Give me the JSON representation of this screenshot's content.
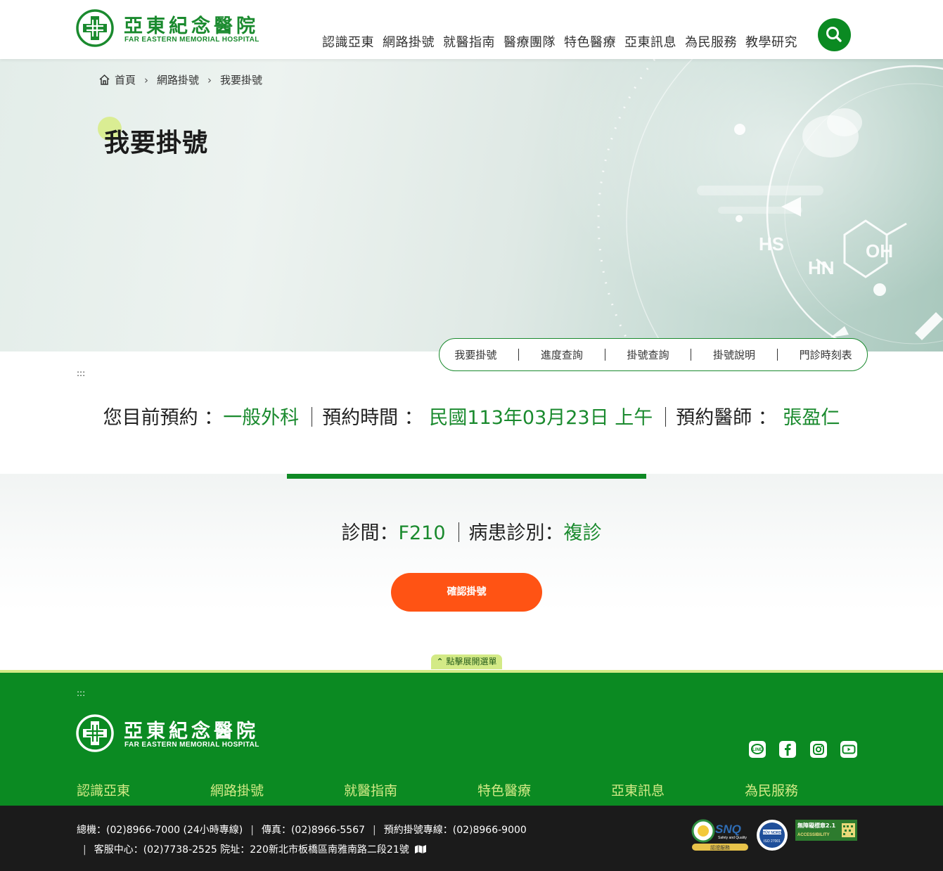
{
  "header": {
    "logo_cn": "亞東紀念醫院",
    "logo_en": "FAR EASTERN MEMORIAL HOSPITAL",
    "nav": [
      "認識亞東",
      "網路掛號",
      "就醫指南",
      "醫療團隊",
      "特色醫療",
      "亞東訊息",
      "為民服務",
      "教學研究"
    ],
    "search_icon": "search-icon"
  },
  "banner": {
    "breadcrumb": [
      "首頁",
      "網路掛號",
      "我要掛號"
    ],
    "title": "我要掛號",
    "art_labels": {
      "hs": "HS",
      "hn": "HN",
      "oh": "OH"
    }
  },
  "subnav": [
    "我要掛號",
    "進度查詢",
    "掛號查詢",
    "掛號說明",
    "門診時刻表"
  ],
  "accesskey": ":::",
  "summary": {
    "dept_label": "您目前預約 ：",
    "dept_value": "一般外科",
    "time_label": "預約時間 ：",
    "time_value": " 民國113年03月23日 上午",
    "doctor_label": "預約醫師 ：",
    "doctor_value": " 張盈仁"
  },
  "details": {
    "room_label": "診間：",
    "room_value": "F210",
    "type_label": "病患診別：",
    "type_value": "複診"
  },
  "confirm_button": "確認掛號",
  "expand_menu": "點擊展開選單",
  "footer": {
    "accesskey": ":::",
    "logo_cn": "亞東紀念醫院",
    "logo_en": "FAR EASTERN MEMORIAL HOSPITAL",
    "social": [
      "line-icon",
      "facebook-icon",
      "instagram-icon",
      "youtube-icon"
    ],
    "nav": [
      "認識亞東",
      "網路掛號",
      "就醫指南",
      "特色醫療",
      "亞東訊息",
      "為民服務"
    ],
    "contact_line1": [
      "總機：(02)8966-7000 (24小時專線)",
      "傳真：(02)8966-5567",
      "預約掛號專線：(02)8966-9000"
    ],
    "contact_line2": "客服中心：(02)7738-2525 院址：220新北市板橋區南雅南路二段21號",
    "badges": {
      "snq_text": "SNQ",
      "snq_sub": "Safety and Quality",
      "snq_ribbon": "認證服務",
      "tuv_text": "TÜV NORD",
      "tuv_sub": "ISO 27001",
      "access_title": "無障礙標章2.1",
      "access_sub": "ACCESSIBILITY"
    }
  },
  "colors": {
    "brand_green": "#0b8a22",
    "accent_lime": "#d3ea86",
    "confirm_orange": "#ff5314",
    "footer_dark": "#1b1b1b"
  }
}
